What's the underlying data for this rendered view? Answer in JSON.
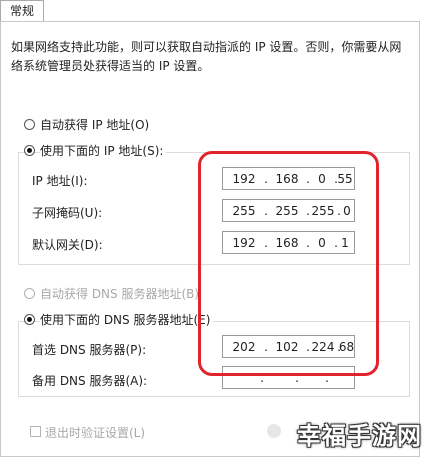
{
  "tab": {
    "label": "常规"
  },
  "description": "如果网络支持此功能，则可以获取自动指派的 IP 设置。否则，你需要从网络系统管理员处获得适当的 IP 设置。",
  "ip_section": {
    "auto_label": "自动获得 IP 地址(O)",
    "manual_label": "使用下面的 IP 地址(S):",
    "fields": [
      {
        "label": "IP 地址(I):",
        "octets": [
          "192",
          "168",
          "0",
          "55"
        ]
      },
      {
        "label": "子网掩码(U):",
        "octets": [
          "255",
          "255",
          "255",
          "0"
        ]
      },
      {
        "label": "默认网关(D):",
        "octets": [
          "192",
          "168",
          "0",
          "1"
        ]
      }
    ]
  },
  "dns_section": {
    "auto_label": "自动获得 DNS 服务器地址(B)",
    "manual_label": "使用下面的 DNS 服务器地址(E)",
    "fields": [
      {
        "label": "首选 DNS 服务器(P):",
        "octets": [
          "202",
          "102",
          "224",
          "68"
        ]
      },
      {
        "label": "备用 DNS 服务器(A):",
        "octets": [
          "",
          "",
          "",
          ""
        ]
      }
    ]
  },
  "validate_on_exit_label": "退出时验证设置(L)",
  "watermark": "幸福手游网",
  "colors": {
    "highlight": "#e0242a",
    "disabled_text": "#a8a8a8"
  }
}
